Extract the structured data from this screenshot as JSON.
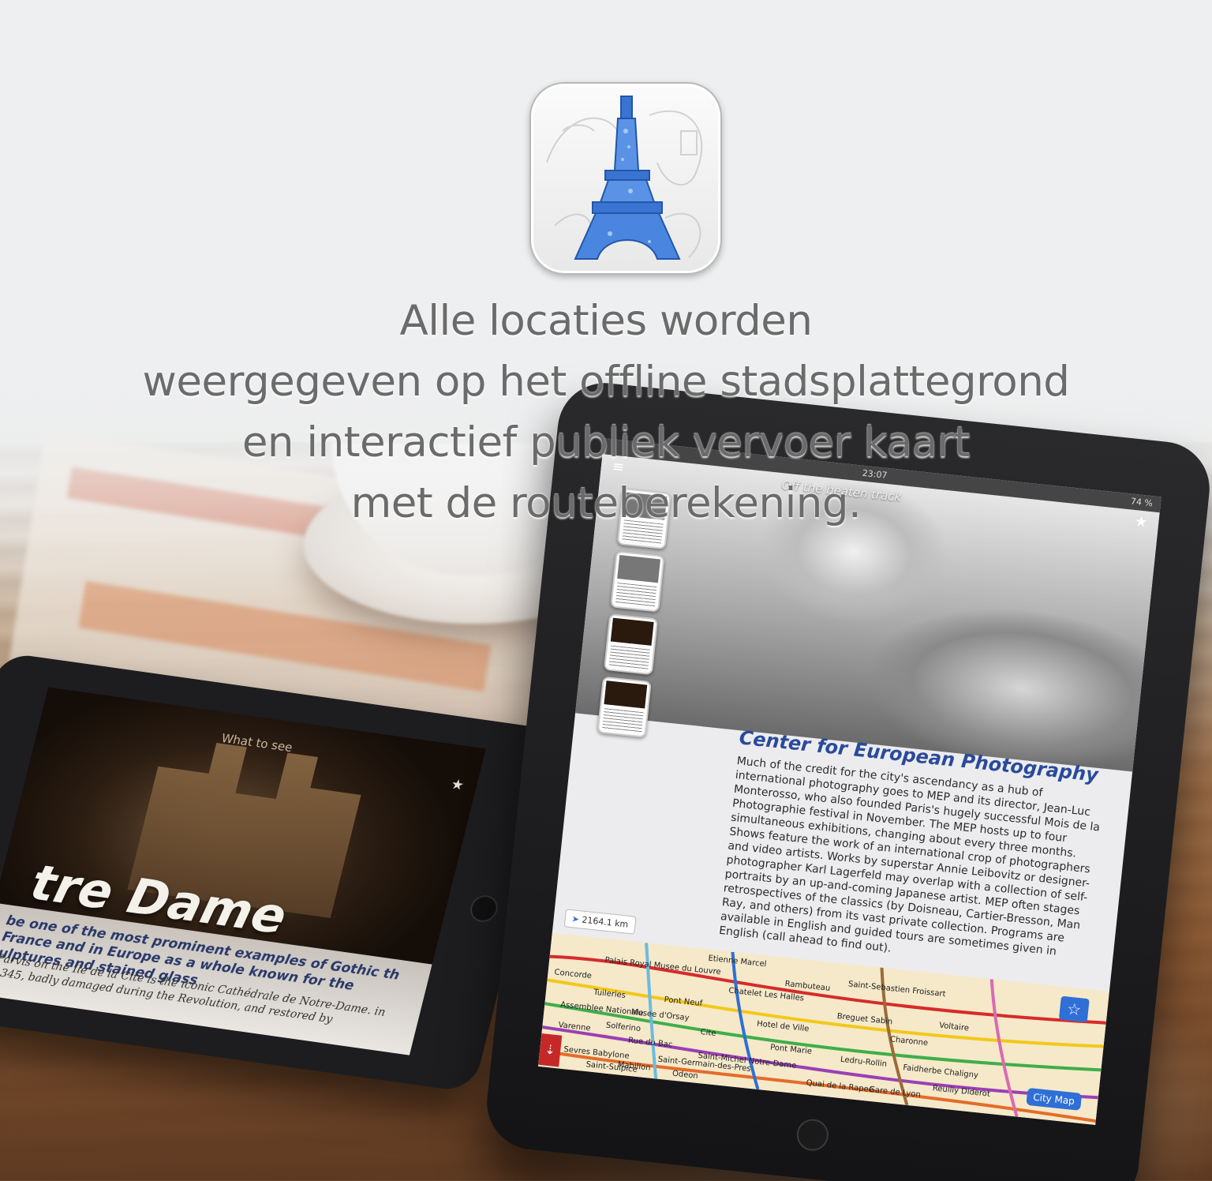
{
  "headline": {
    "line1": "Alle locaties worden",
    "line2": "weergegeven op het offline stadsplattegrond",
    "line3": "en interactief publiek vervoer kaart",
    "line4": "met de routeberekening."
  },
  "app_icon": {
    "icon": "eiffel-tower-icon",
    "accent": "#3a74d2"
  },
  "left_tablet": {
    "nav_title": "What to see",
    "heading": "tre Dame",
    "subtitle": "be one of the most prominent examples of Gothic th France and in Europe as a whole known for the ulptures and stained glass",
    "body": "Parvis on the Ile de la Cité is the iconic Cathédrale de Notre-Dame. in 1345, badly damaged during the Revolution, and restored by"
  },
  "right_tablet": {
    "status_time": "23:07",
    "status_battery": "74 %",
    "nav_title": "Off the beaten track",
    "article_title": "Center for European Photography",
    "article_body": "Much of the credit for the city's ascendancy as a hub of international photography goes to MEP and its director, Jean-Luc Monterosso, who also founded Paris's hugely successful Mois de la Photographie festival in November. The MEP hosts up to four simultaneous exhibitions, changing about every three months. Shows feature the work of an international crop of photographers and video artists. Works by superstar Annie Leibovitz or designer-photographer Karl Lagerfeld may overlap with a collection of self-portraits by an up-and-coming Japanese artist. MEP often stages retrospectives of the classics (by Doisneau, Cartier-Bresson, Man Ray, and others) from its vast private collection. Programs are available in English and guided tours are sometimes given in English (call ahead to find out).",
    "distance": "2164.1 km",
    "city_map_button": "City Map",
    "map_stations": [
      "Palais Royal Musee du Louvre",
      "Etienne Marcel",
      "Concorde",
      "Chatelet Les Halles",
      "Tuileries",
      "Pont Neuf",
      "Rambuteau",
      "Hotel de Ville",
      "Saint-Sebastien Froissart",
      "Assemblee Nationale",
      "Musee d'Orsay",
      "Cite",
      "Pont Marie",
      "Saint-Michel Notre-Dame",
      "Varenne",
      "Solferino",
      "Rue du Bac",
      "Saint-Germain-des-Pres",
      "Breguet Sabin",
      "Charonne",
      "Voltaire",
      "Ledru-Rollin",
      "Faidherbe Chaligny",
      "Sevres Babylone",
      "Mabillon",
      "Odeon",
      "Saint-Sulpice",
      "Quai de la Rapee",
      "Gare de Lyon",
      "Reuilly Diderot"
    ]
  }
}
